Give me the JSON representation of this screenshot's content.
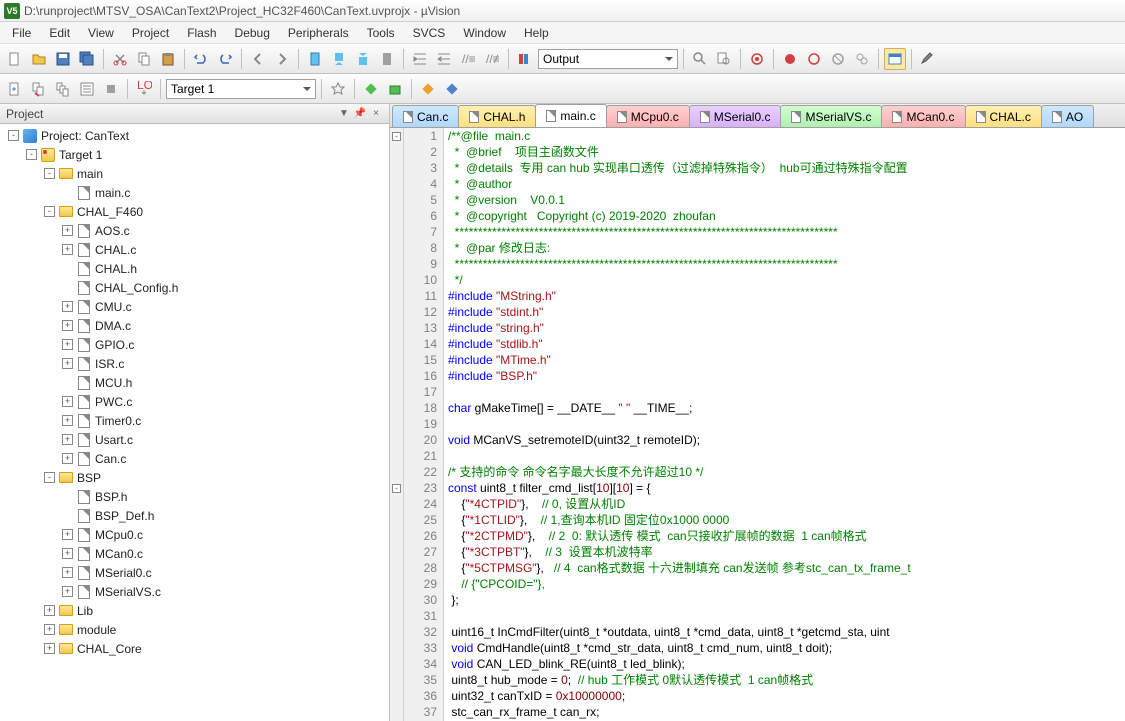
{
  "window": {
    "title": "D:\\runproject\\MTSV_OSA\\CanText2\\Project_HC32F460\\CanText.uvprojx - µVision",
    "icon_label": "V5"
  },
  "menu": [
    "File",
    "Edit",
    "View",
    "Project",
    "Flash",
    "Debug",
    "Peripherals",
    "Tools",
    "SVCS",
    "Window",
    "Help"
  ],
  "toolbar1": {
    "output_label": "Output"
  },
  "toolbar2": {
    "target": "Target 1"
  },
  "panel": {
    "title": "Project",
    "close": "×",
    "pin": "▾",
    "drop": "▼"
  },
  "tree": [
    {
      "depth": 0,
      "exp": "-",
      "icon": "project",
      "label": "Project: CanText"
    },
    {
      "depth": 1,
      "exp": "-",
      "icon": "target",
      "label": "Target 1"
    },
    {
      "depth": 2,
      "exp": "-",
      "icon": "folder",
      "label": "main"
    },
    {
      "depth": 3,
      "exp": "",
      "icon": "file",
      "label": "main.c"
    },
    {
      "depth": 2,
      "exp": "-",
      "icon": "folder",
      "label": "CHAL_F460"
    },
    {
      "depth": 3,
      "exp": "+",
      "icon": "file",
      "label": "AOS.c"
    },
    {
      "depth": 3,
      "exp": "+",
      "icon": "file",
      "label": "CHAL.c"
    },
    {
      "depth": 3,
      "exp": "",
      "icon": "file",
      "label": "CHAL.h"
    },
    {
      "depth": 3,
      "exp": "",
      "icon": "file",
      "label": "CHAL_Config.h"
    },
    {
      "depth": 3,
      "exp": "+",
      "icon": "file",
      "label": "CMU.c"
    },
    {
      "depth": 3,
      "exp": "+",
      "icon": "file",
      "label": "DMA.c"
    },
    {
      "depth": 3,
      "exp": "+",
      "icon": "file",
      "label": "GPIO.c"
    },
    {
      "depth": 3,
      "exp": "+",
      "icon": "file",
      "label": "ISR.c"
    },
    {
      "depth": 3,
      "exp": "",
      "icon": "file",
      "label": "MCU.h"
    },
    {
      "depth": 3,
      "exp": "+",
      "icon": "file",
      "label": "PWC.c"
    },
    {
      "depth": 3,
      "exp": "+",
      "icon": "file",
      "label": "Timer0.c"
    },
    {
      "depth": 3,
      "exp": "+",
      "icon": "file",
      "label": "Usart.c"
    },
    {
      "depth": 3,
      "exp": "+",
      "icon": "file",
      "label": "Can.c"
    },
    {
      "depth": 2,
      "exp": "-",
      "icon": "folder",
      "label": "BSP"
    },
    {
      "depth": 3,
      "exp": "",
      "icon": "file",
      "label": "BSP.h"
    },
    {
      "depth": 3,
      "exp": "",
      "icon": "file",
      "label": "BSP_Def.h"
    },
    {
      "depth": 3,
      "exp": "+",
      "icon": "file",
      "label": "MCpu0.c"
    },
    {
      "depth": 3,
      "exp": "+",
      "icon": "file",
      "label": "MCan0.c"
    },
    {
      "depth": 3,
      "exp": "+",
      "icon": "file",
      "label": "MSerial0.c"
    },
    {
      "depth": 3,
      "exp": "+",
      "icon": "file",
      "label": "MSerialVS.c"
    },
    {
      "depth": 2,
      "exp": "+",
      "icon": "folder",
      "label": "Lib"
    },
    {
      "depth": 2,
      "exp": "+",
      "icon": "folder",
      "label": "module"
    },
    {
      "depth": 2,
      "exp": "+",
      "icon": "folder",
      "label": "CHAL_Core"
    }
  ],
  "tabs": [
    {
      "label": "Can.c",
      "cls": "tab-blue"
    },
    {
      "label": "CHAL.h",
      "cls": "tab-yellow"
    },
    {
      "label": "main.c",
      "cls": "active"
    },
    {
      "label": "MCpu0.c",
      "cls": "tab-red"
    },
    {
      "label": "MSerial0.c",
      "cls": "tab-purple"
    },
    {
      "label": "MSerialVS.c",
      "cls": "tab-green"
    },
    {
      "label": "MCan0.c",
      "cls": "tab-red"
    },
    {
      "label": "CHAL.c",
      "cls": "tab-yellow"
    },
    {
      "label": "AO",
      "cls": "tab-blue"
    }
  ],
  "code": [
    {
      "n": 1,
      "fold": "-",
      "html": "<span class='c-green'>/**@file  main.c</span>"
    },
    {
      "n": 2,
      "html": "<span class='c-green'>  *  @brief    项目主函数文件</span>"
    },
    {
      "n": 3,
      "html": "<span class='c-green'>  *  @details  专用 can hub 实现串口透传（过滤掉特殊指令）  hub可通过特殊指令配置</span>"
    },
    {
      "n": 4,
      "html": "<span class='c-green'>  *  @author</span>"
    },
    {
      "n": 5,
      "html": "<span class='c-green'>  *  @version    V0.0.1</span>"
    },
    {
      "n": 6,
      "html": "<span class='c-green'>  *  @copyright   Copyright (c) 2019-2020  zhoufan</span>"
    },
    {
      "n": 7,
      "html": "<span class='c-green'>  **********************************************************************************</span>"
    },
    {
      "n": 8,
      "html": "<span class='c-green'>  *  @par 修改日志:</span>"
    },
    {
      "n": 9,
      "html": "<span class='c-green'>  **********************************************************************************</span>"
    },
    {
      "n": 10,
      "html": "<span class='c-green'>  */</span>"
    },
    {
      "n": 11,
      "html": "<span class='c-blue'>#include</span> <span class='c-str'>\"MString.h\"</span>"
    },
    {
      "n": 12,
      "html": "<span class='c-blue'>#include</span> <span class='c-str'>\"stdint.h\"</span>"
    },
    {
      "n": 13,
      "html": "<span class='c-blue'>#include</span> <span class='c-str'>\"string.h\"</span>"
    },
    {
      "n": 14,
      "html": "<span class='c-blue'>#include</span> <span class='c-str'>\"stdlib.h\"</span>"
    },
    {
      "n": 15,
      "html": "<span class='c-blue'>#include</span> <span class='c-str'>\"MTime.h\"</span>"
    },
    {
      "n": 16,
      "html": "<span class='c-blue'>#include</span> <span class='c-str'>\"BSP.h\"</span>"
    },
    {
      "n": 17,
      "html": ""
    },
    {
      "n": 18,
      "html": "<span class='c-blue'>char</span> gMakeTime[] = __DATE__ <span class='c-str'>\" \"</span> __TIME__;"
    },
    {
      "n": 19,
      "html": ""
    },
    {
      "n": 20,
      "html": "<span class='c-blue'>void</span> MCanVS_setremoteID(uint32_t remoteID);"
    },
    {
      "n": 21,
      "html": ""
    },
    {
      "n": 22,
      "html": "<span class='c-green'>/* 支持的命令 命令名字最大长度不允许超过10 */</span>"
    },
    {
      "n": 23,
      "fold": "-",
      "html": "<span class='c-blue'>const</span> uint8_t filter_cmd_list[<span class='c-num'>10</span>][<span class='c-num'>10</span>] = {"
    },
    {
      "n": 24,
      "html": "    {<span class='c-str'>\"*4CTPID\"</span>},    <span class='c-green'>// 0, 设置从机ID</span>"
    },
    {
      "n": 25,
      "html": "    {<span class='c-str'>\"*1CTLID\"</span>},    <span class='c-green'>// 1,查询本机ID 固定位0x1000 0000</span>"
    },
    {
      "n": 26,
      "html": "    {<span class='c-str'>\"*2CTPMD\"</span>},    <span class='c-green'>// 2  0: 默认透传 模式  can只接收扩展帧的数据  1 can帧格式</span>"
    },
    {
      "n": 27,
      "html": "    {<span class='c-str'>\"*3CTPBT\"</span>},    <span class='c-green'>// 3  设置本机波特率</span>"
    },
    {
      "n": 28,
      "html": "    {<span class='c-str'>\"*5CTPMSG\"</span>},   <span class='c-green'>// 4  can格式数据 十六进制填充 can发送帧 参考stc_can_tx_frame_t</span>"
    },
    {
      "n": 29,
      "html": "    <span class='c-green'>// {\"CPCOID=\"},</span>"
    },
    {
      "n": 30,
      "html": " };"
    },
    {
      "n": 31,
      "html": ""
    },
    {
      "n": 32,
      "html": " uint16_t InCmdFilter(uint8_t *outdata, uint8_t *cmd_data, uint8_t *getcmd_sta, uint"
    },
    {
      "n": 33,
      "html": " <span class='c-blue'>void</span> CmdHandle(uint8_t *cmd_str_data, uint8_t cmd_num, uint8_t doit);"
    },
    {
      "n": 34,
      "html": " <span class='c-blue'>void</span> CAN_LED_blink_RE(uint8_t led_blink);"
    },
    {
      "n": 35,
      "html": " uint8_t hub_mode = <span class='c-num'>0</span>;  <span class='c-green'>// hub 工作模式 0默认透传模式  1 can帧格式</span>"
    },
    {
      "n": 36,
      "html": " uint32_t canTxID = <span class='c-num'>0x10000000</span>;"
    },
    {
      "n": 37,
      "html": " stc_can_rx_frame_t can_rx;"
    }
  ]
}
